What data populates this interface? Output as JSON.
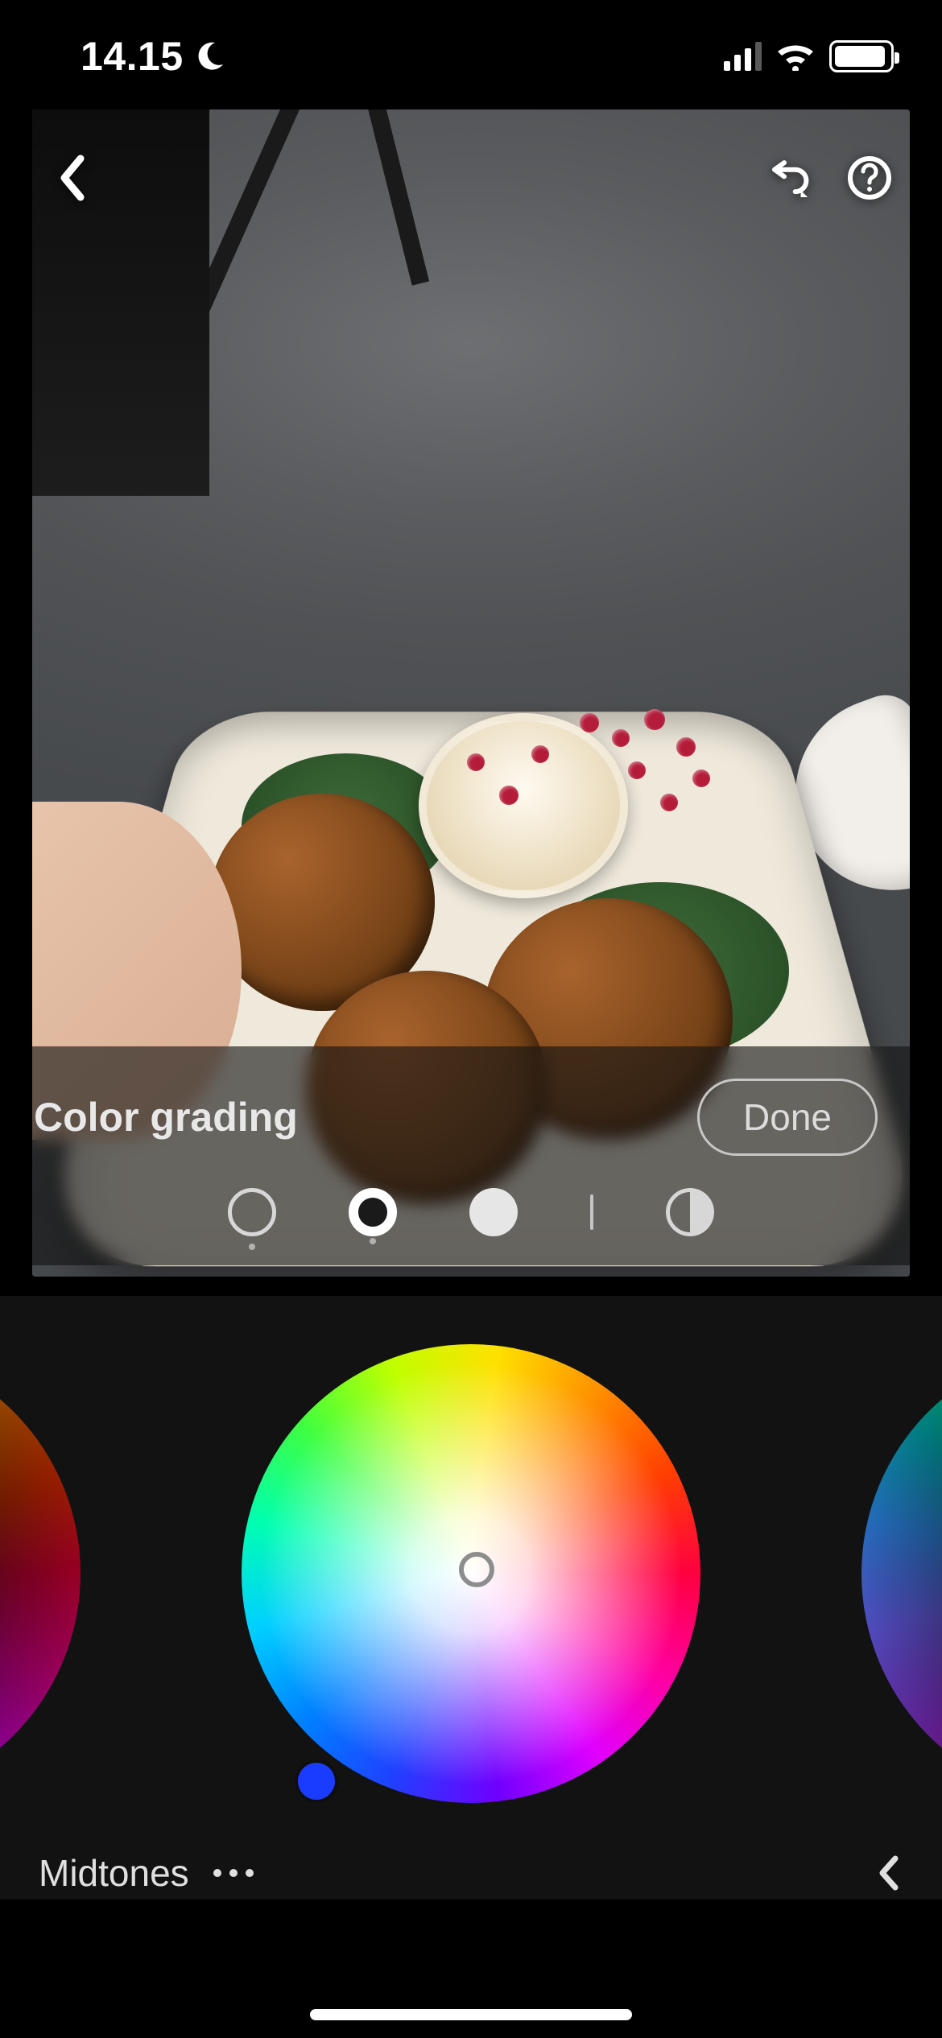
{
  "status": {
    "time": "14.15",
    "dnd": true,
    "signal_bars_active": 3,
    "wifi": true,
    "battery_pct": 85
  },
  "editor": {
    "panel_title": "Color grading",
    "done_label": "Done",
    "modes": {
      "shadows": {
        "selected": false
      },
      "midtones": {
        "selected": true
      },
      "highlights": {
        "selected": false
      },
      "global": {
        "selected": false
      }
    },
    "active_range_label": "Midtones",
    "color_wheel": {
      "hue": 0,
      "saturation": 0,
      "luminance_angle_deg": 225
    }
  }
}
